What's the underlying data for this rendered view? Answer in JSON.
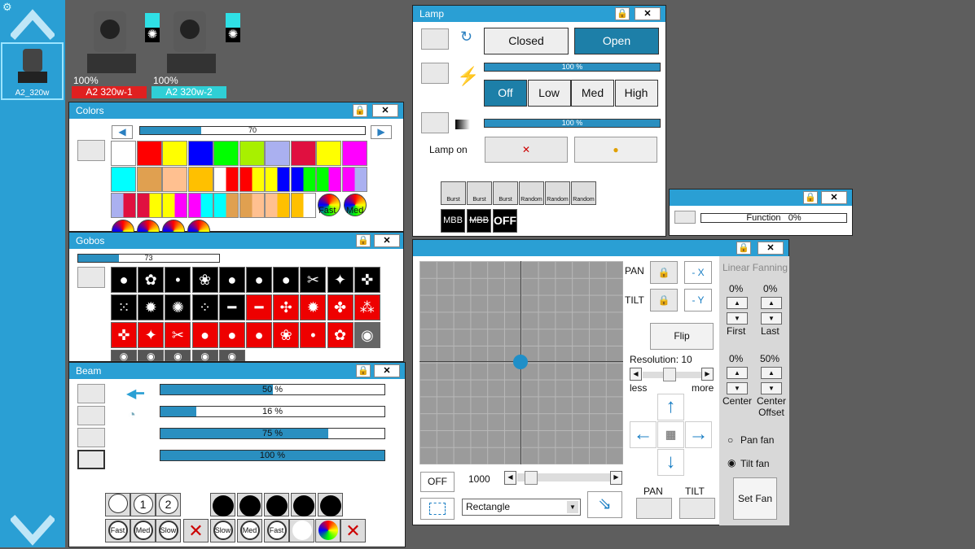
{
  "sidebar": {
    "fixture_label": "A2_320w"
  },
  "fixtures": [
    {
      "percent": "100%",
      "name": "A2 320w-1",
      "color": "#e02020"
    },
    {
      "percent": "100%",
      "name": "A2 320w-2",
      "color": "#2fcfd6"
    }
  ],
  "colors": {
    "title": "Colors",
    "slider_value": "70",
    "fast": "Fast",
    "med": "Med"
  },
  "gobos": {
    "title": "Gobos",
    "slider_value": "73"
  },
  "beam": {
    "title": "Beam",
    "bars": [
      "50 %",
      "16 %",
      "75 %",
      "100 %"
    ],
    "bar_fractions": [
      0.5,
      0.16,
      0.75,
      1.0
    ],
    "row1": [
      "1",
      "2"
    ],
    "row2": [
      "Fast",
      "Med",
      "Slow",
      "Slow",
      "Med",
      "Fast"
    ]
  },
  "lamp": {
    "title": "Lamp",
    "closed": "Closed",
    "open": "Open",
    "bar1": "100 %",
    "bar2": "100 %",
    "levels": [
      "Off",
      "Low",
      "Med",
      "High"
    ],
    "lamp_on": "Lamp on",
    "strobe": [
      "Burst",
      "Burst",
      "Burst",
      "Random",
      "Random",
      "Random"
    ],
    "mbb": "MBB",
    "mbb2": "MBB",
    "off": "OFF"
  },
  "function": {
    "label": "Function",
    "value": "0%"
  },
  "position": {
    "pan": "PAN",
    "tilt": "TILT",
    "minus_x": "- X",
    "minus_y": "- Y",
    "flip": "Flip",
    "resolution": "Resolution: 10",
    "less": "less",
    "more": "more",
    "off": "OFF",
    "speed": "1000",
    "shape": "Rectangle",
    "pan_bottom": "PAN",
    "tilt_bottom": "TILT",
    "fanning_title": "Linear Fanning",
    "first_pct": "0%",
    "last_pct": "0%",
    "first": "First",
    "last": "Last",
    "center_pct": "0%",
    "offset_pct": "50%",
    "center": "Center",
    "center_offset": "Center Offset",
    "pan_fan": "Pan fan",
    "tilt_fan": "Tilt fan",
    "set_fan": "Set Fan"
  }
}
